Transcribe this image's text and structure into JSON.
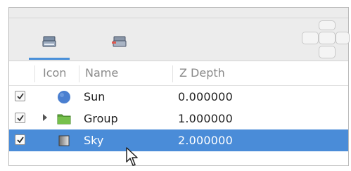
{
  "toolbar": {
    "tabs": [
      {
        "icon": "layers-icon",
        "active": true
      },
      {
        "icon": "layer-properties-icon",
        "active": false
      }
    ]
  },
  "table": {
    "columns": {
      "icon": "Icon",
      "name": "Name",
      "zdepth": "Z Depth"
    },
    "rows": [
      {
        "checked": true,
        "expandable": false,
        "icon": "sphere-icon",
        "name": "Sun",
        "zdepth": "0.000000",
        "selected": false
      },
      {
        "checked": true,
        "expandable": true,
        "icon": "folder-icon",
        "name": "Group",
        "zdepth": "1.000000",
        "selected": false
      },
      {
        "checked": true,
        "expandable": false,
        "icon": "gradient-icon",
        "name": "Sky",
        "zdepth": "2.000000",
        "selected": true
      }
    ]
  },
  "colors": {
    "selection": "#4a8cd8",
    "tab_underline": "#4a90d9",
    "sphere": "#4a7fd0",
    "folder": "#5fa83a"
  }
}
